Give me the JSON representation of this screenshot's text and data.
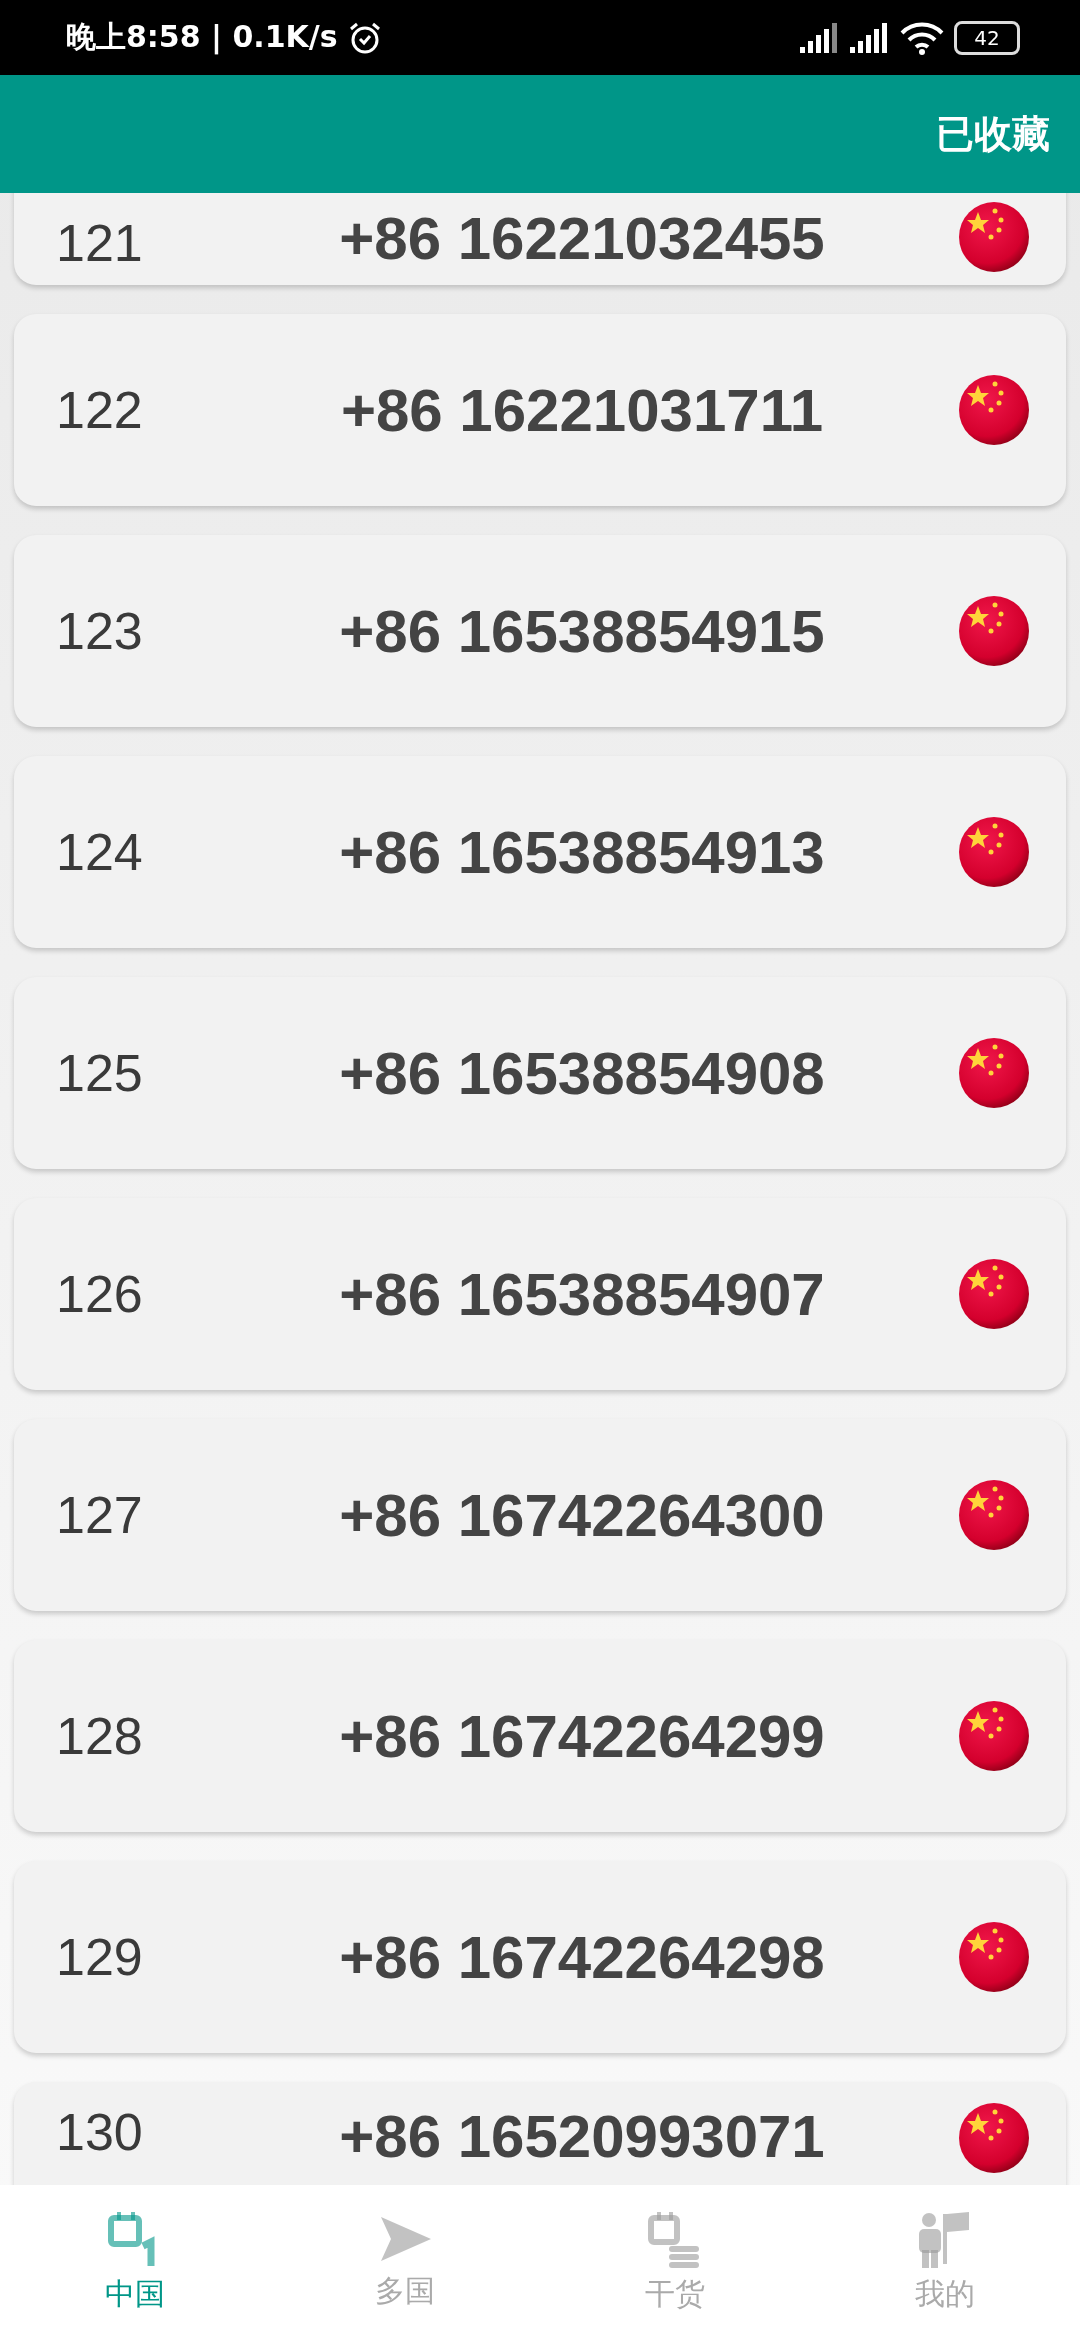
{
  "status_bar": {
    "time": "晚上8:58 | 0.1K/s",
    "battery": "42"
  },
  "app_bar": {
    "action": "已收藏"
  },
  "numbers": [
    {
      "index": "121",
      "phone": "+86 16221032455"
    },
    {
      "index": "122",
      "phone": "+86 16221031711"
    },
    {
      "index": "123",
      "phone": "+86 16538854915"
    },
    {
      "index": "124",
      "phone": "+86 16538854913"
    },
    {
      "index": "125",
      "phone": "+86 16538854908"
    },
    {
      "index": "126",
      "phone": "+86 16538854907"
    },
    {
      "index": "127",
      "phone": "+86 16742264300"
    },
    {
      "index": "128",
      "phone": "+86 16742264299"
    },
    {
      "index": "129",
      "phone": "+86 16742264298"
    },
    {
      "index": "130",
      "phone": "+86 16520993071"
    }
  ],
  "bottom_nav": [
    {
      "label": "中国",
      "kind": "calendar-one",
      "selected": true
    },
    {
      "label": "多国",
      "kind": "send",
      "selected": false
    },
    {
      "label": "干货",
      "kind": "calendar-list",
      "selected": false
    },
    {
      "label": "我的",
      "kind": "person-flag",
      "selected": false
    }
  ]
}
